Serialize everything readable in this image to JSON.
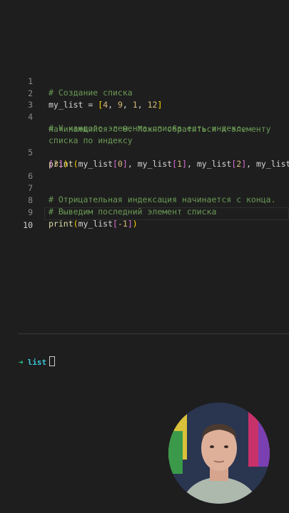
{
  "editor": {
    "lines": [
      {
        "n": "1",
        "t": "# Создание списка"
      },
      {
        "n": "2",
        "parts": [
          "my_list",
          " = ",
          "[",
          "4",
          ", ",
          "9",
          ", ",
          "1",
          ", ",
          "12",
          "]"
        ]
      },
      {
        "n": "3"
      },
      {
        "n": "4",
        "t": "# У каждого элемента списка есть индекс,"
      },
      {
        "cont": "начинающийся с 0. Можно обратиться к элементу"
      },
      {
        "cont": "списка по индексу"
      },
      {
        "n": "5",
        "parts": [
          "print",
          "(",
          "my_list",
          "[",
          "0",
          "]",
          ", ",
          "my_list",
          "[",
          "1",
          "]",
          ", ",
          "my_list",
          "[",
          "2",
          "]",
          ", ",
          "my_list"
        ]
      },
      {
        "cont_parts": [
          "[",
          "3",
          "]",
          ")"
        ]
      },
      {
        "n": "6"
      },
      {
        "n": "7",
        "t": "# Отрицательная индексация начинается с конца."
      },
      {
        "n": "8",
        "t": "# Выведим последний элемент списка"
      },
      {
        "n": "9",
        "parts": [
          "print",
          "(",
          "my_list",
          "[",
          "-1",
          "]",
          ")"
        ]
      },
      {
        "n": "10"
      }
    ],
    "current_line": "10"
  },
  "terminal": {
    "prompt_symbol": "➜",
    "directory": "list"
  },
  "colors": {
    "background": "#1e1e1e",
    "comment": "#6a9955",
    "number": "#d7ba7d",
    "function": "#dcdcaa",
    "bracket_outer": "#ffd700",
    "bracket_inner": "#da70d6",
    "prompt_arrow": "#23d18b",
    "prompt_dir": "#3bc4d9"
  }
}
